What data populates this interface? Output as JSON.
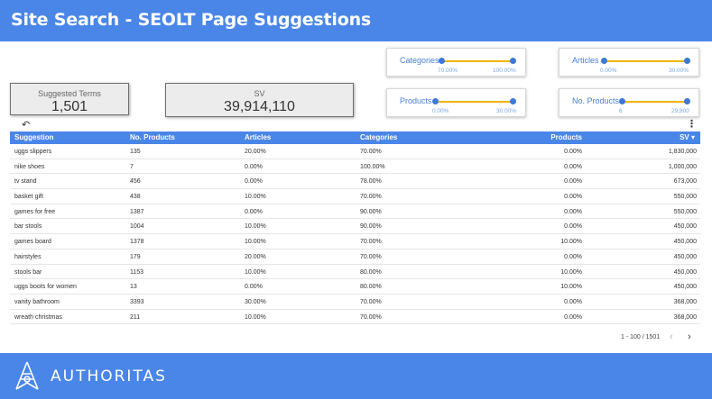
{
  "header": {
    "title": "Site Search - SEOLT Page Suggestions"
  },
  "scorecards": {
    "suggested_terms": {
      "label": "Suggested Terms",
      "value": "1,501"
    },
    "sv": {
      "label": "SV",
      "value": "39,914,110"
    }
  },
  "filters": {
    "categories": {
      "label": "Categories",
      "min": "70.00%",
      "max": "100.00%"
    },
    "articles": {
      "label": "Articles",
      "min": "0.00%",
      "max": "30.00%"
    },
    "products": {
      "label": "Products",
      "min": "0.00%",
      "max": "30.00%"
    },
    "no_products": {
      "label": "No. Products",
      "min": "6",
      "max": "29,800"
    }
  },
  "table": {
    "headers": [
      "Suggestion",
      "No. Products",
      "Articles",
      "Categories",
      "Products",
      "SV ▾"
    ],
    "rows": [
      [
        "uggs slippers",
        "135",
        "20.00%",
        "70.00%",
        "0.00%",
        "1,830,000"
      ],
      [
        "nike shoes",
        "7",
        "0.00%",
        "100.00%",
        "0.00%",
        "1,000,000"
      ],
      [
        "tv stand",
        "456",
        "0.00%",
        "78.00%",
        "0.00%",
        "673,000"
      ],
      [
        "basket gift",
        "438",
        "10.00%",
        "70.00%",
        "0.00%",
        "550,000"
      ],
      [
        "games for free",
        "1387",
        "0.00%",
        "90.00%",
        "0.00%",
        "550,000"
      ],
      [
        "bar stools",
        "1004",
        "10.00%",
        "90.00%",
        "0.00%",
        "450,000"
      ],
      [
        "games board",
        "1378",
        "10.00%",
        "70.00%",
        "10.00%",
        "450,000"
      ],
      [
        "hairstyles",
        "179",
        "20.00%",
        "70.00%",
        "0.00%",
        "450,000"
      ],
      [
        "stools bar",
        "1153",
        "10.00%",
        "80.00%",
        "10.00%",
        "450,000"
      ],
      [
        "uggs boots for women",
        "13",
        "0.00%",
        "80.00%",
        "10.00%",
        "450,000"
      ],
      [
        "vanity bathroom",
        "3393",
        "30.00%",
        "70.00%",
        "0.00%",
        "368,000"
      ],
      [
        "wreath christmas",
        "211",
        "10.00%",
        "70.00%",
        "0.00%",
        "368,000"
      ],
      [
        "",
        "",
        "",
        "",
        "",
        ""
      ]
    ],
    "pagination": "1 - 100 / 1501"
  },
  "footer": {
    "brand": "AUTHORITAS"
  },
  "icons": {
    "undo": "undo-icon",
    "more": "more-vert-icon",
    "prev": "chevron-left-icon",
    "next": "chevron-right-icon",
    "logo": "authoritas-logo-icon"
  },
  "colors": {
    "brand_blue": "#4a86e8",
    "slider_track": "#f0b400",
    "slider_dot": "#3c78d8"
  }
}
